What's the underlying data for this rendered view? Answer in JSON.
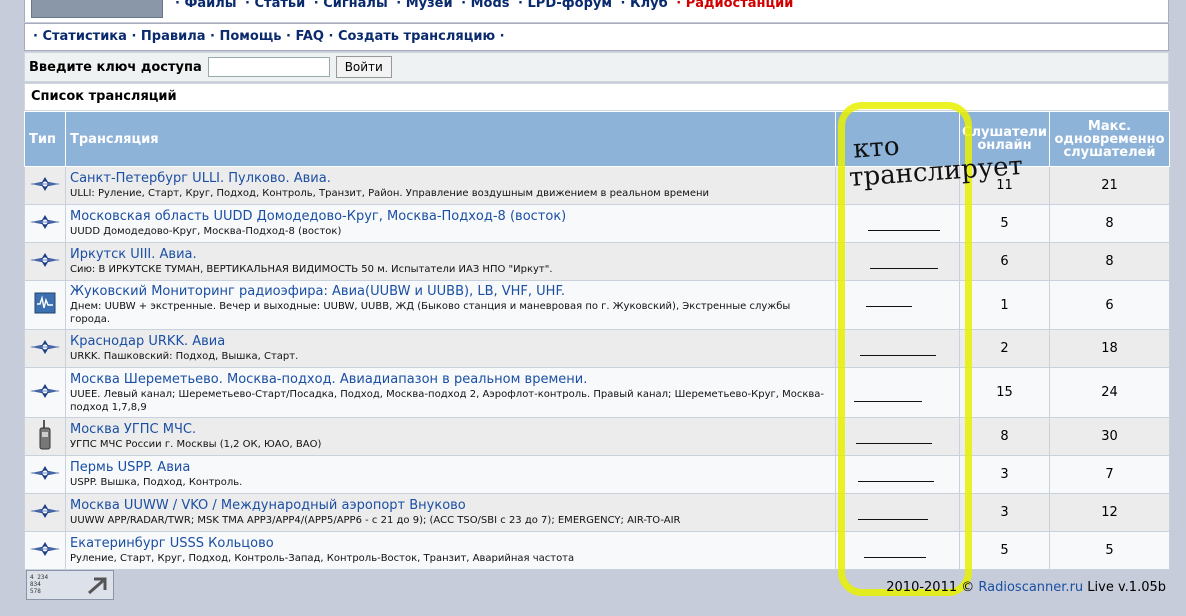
{
  "top_nav": [
    "· Файлы",
    "· Статьи",
    "· Сигналы",
    "· Музеи",
    "· Mods",
    "· LPD-форум",
    "· Клуб",
    "· Радиостанции"
  ],
  "sub_nav": [
    "· Статистика",
    "· Правила",
    "· Помощь",
    "· FAQ",
    "· Создать трансляцию ·"
  ],
  "access": {
    "label": "Введите ключ доступа",
    "value": "",
    "button": "Войти"
  },
  "list_title": "Список трансляций",
  "columns": {
    "type": "Тип",
    "stream": "Трансляция",
    "listeners": "Слушатели онлайн",
    "max": "Макс. одновременно слушателей"
  },
  "annotation": {
    "line1": "кто",
    "line2": "транслирует"
  },
  "rows": [
    {
      "icon": "plane-icon",
      "title": "Санкт-Петербург ULLI. Пулково. Авиа.",
      "desc": "ULLI: Руление, Старт, Круг, Подход, Контроль, Транзит, Район. Управление воздушным движением в реальном времени",
      "online": "11",
      "max": "21"
    },
    {
      "icon": "plane-icon",
      "title": "Московская область UUDD Домодедово-Круг, Москва-Подход-8 (восток)",
      "desc": "UUDD Домодедово-Круг, Москва-Подход-8 (восток)",
      "online": "5",
      "max": "8"
    },
    {
      "icon": "plane-icon",
      "title": "Иркутск UIII. Авиа.",
      "desc": "Сию: В ИРКУТСКЕ ТУМАН, ВЕРТИКАЛЬНАЯ ВИДИМОСТЬ 50 м. Испытатели ИАЗ НПО \"Иркут\".",
      "online": "6",
      "max": "8"
    },
    {
      "icon": "monitor-icon",
      "title": "Жуковский Мониторинг радиоэфира: Авиа(UUBW и UUBB), LB, VHF, UHF.",
      "desc": "Днем: UUBW + экстренные. Вечер и выходные: UUBW, UUBB, ЖД (Быково станция и маневровая по г. Жуковский), Экстренные службы города.",
      "online": "1",
      "max": "6"
    },
    {
      "icon": "plane-icon",
      "title": "Краснодар URKK. Авиа",
      "desc": "URKK. Пашковский: Подход, Вышка, Старт.",
      "online": "2",
      "max": "18"
    },
    {
      "icon": "plane-icon",
      "title": "Москва Шереметьево. Москва-подход. Авиадиапазон в реальном времени.",
      "desc": "UUEE. Левый канал; Шереметьево-Старт/Посадка, Подход, Москва-подход 2, Аэрофлот-контроль. Правый канал; Шереметьево-Круг, Москва-подход 1,7,8,9",
      "online": "15",
      "max": "24"
    },
    {
      "icon": "radio-icon",
      "title": "Москва УГПС МЧС.",
      "desc": "УГПС МЧС России г. Москвы (1,2 ОК, ЮАО, ВАО)",
      "online": "8",
      "max": "30"
    },
    {
      "icon": "plane-icon",
      "title": "Пермь USPP. Авиа",
      "desc": "USPP. Вышка, Подход, Контроль.",
      "online": "3",
      "max": "7"
    },
    {
      "icon": "plane-icon",
      "title": "Москва UUWW / VKO / Международный аэропорт Внуково",
      "desc": "UUWW APP/RADAR/TWR; MSK TMA APP3/APP4/(APP5/APP6 - с 21 до 9); (ACC TSO/SBI с 23 до 7); EMERGENCY; AIR-TO-AIR",
      "online": "3",
      "max": "12"
    },
    {
      "icon": "plane-icon",
      "title": "Екатеринбург USSS Кольцово",
      "desc": "Руление, Старт, Круг, Подход, Контроль-Запад, Контроль-Восток, Транзит, Аварийная частота",
      "online": "5",
      "max": "5"
    }
  ],
  "footer": {
    "years": "2010-2011 ©",
    "site": "Radioscanner.ru",
    "version": "Live v.1.05b"
  },
  "counter": {
    "line1": "4 234",
    "line2": "834",
    "line3": "578"
  },
  "colors": {
    "header_bg": "#8eb3d9",
    "link": "#1b4fa3",
    "highlight": "#e8f000",
    "active_nav": "#d00000"
  }
}
